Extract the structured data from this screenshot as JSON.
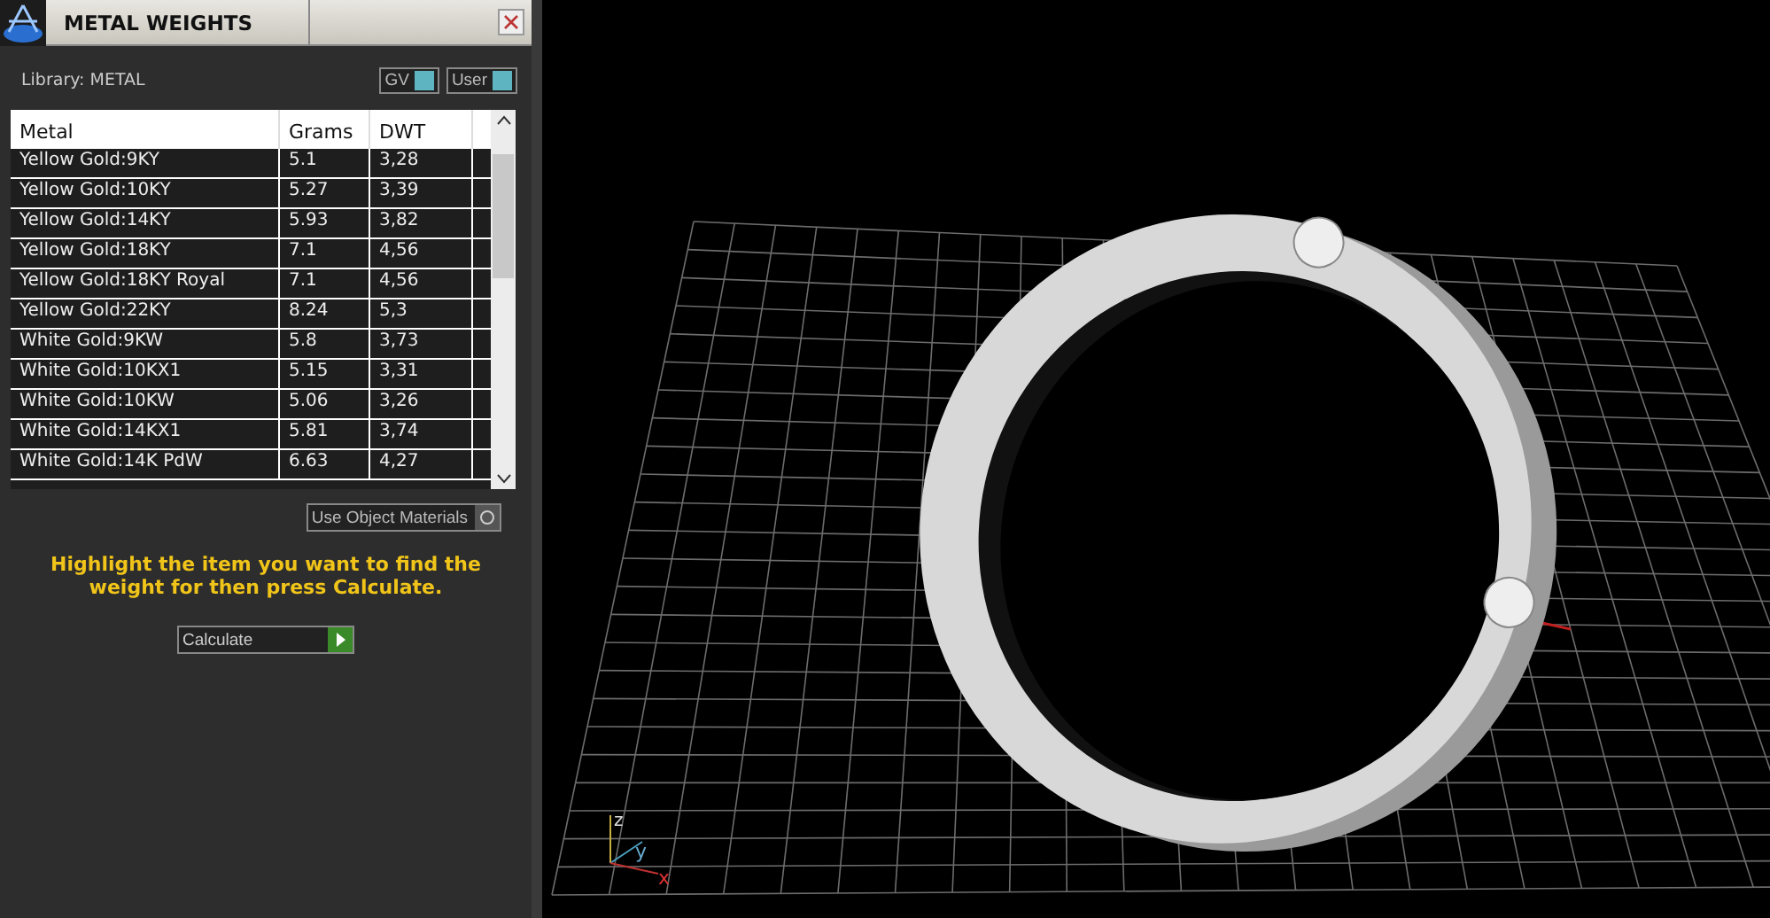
{
  "panel": {
    "title": "METAL WEIGHTS",
    "library": "Library: METAL",
    "toggles": [
      {
        "label": "GV",
        "on": true
      },
      {
        "label": "User",
        "on": true
      }
    ],
    "table": {
      "columns": [
        "Metal",
        "Grams",
        "DWT"
      ],
      "rows": [
        [
          "Yellow Gold:9KY",
          "5.1",
          "3,28"
        ],
        [
          "Yellow Gold:10KY",
          "5.27",
          "3,39"
        ],
        [
          "Yellow Gold:14KY",
          "5.93",
          "3,82"
        ],
        [
          "Yellow Gold:18KY",
          "7.1",
          "4,56"
        ],
        [
          "Yellow Gold:18KY Royal",
          "7.1",
          "4,56"
        ],
        [
          "Yellow Gold:22KY",
          "8.24",
          "5,3"
        ],
        [
          "White Gold:9KW",
          "5.8",
          "3,73"
        ],
        [
          "White Gold:10KX1",
          "5.15",
          "3,31"
        ],
        [
          "White Gold:10KW",
          "5.06",
          "3,26"
        ],
        [
          "White Gold:14KX1",
          "5.81",
          "3,74"
        ],
        [
          "White Gold:14K PdW",
          "6.63",
          "4,27"
        ]
      ]
    },
    "use_object_materials": {
      "label": "Use Object Materials",
      "checked": false
    },
    "instruction": "Highlight the item you want to find the weight for then press Calculate.",
    "calculate": "Calculate"
  },
  "viewport": {
    "axes": [
      "z",
      "y",
      "x"
    ]
  }
}
